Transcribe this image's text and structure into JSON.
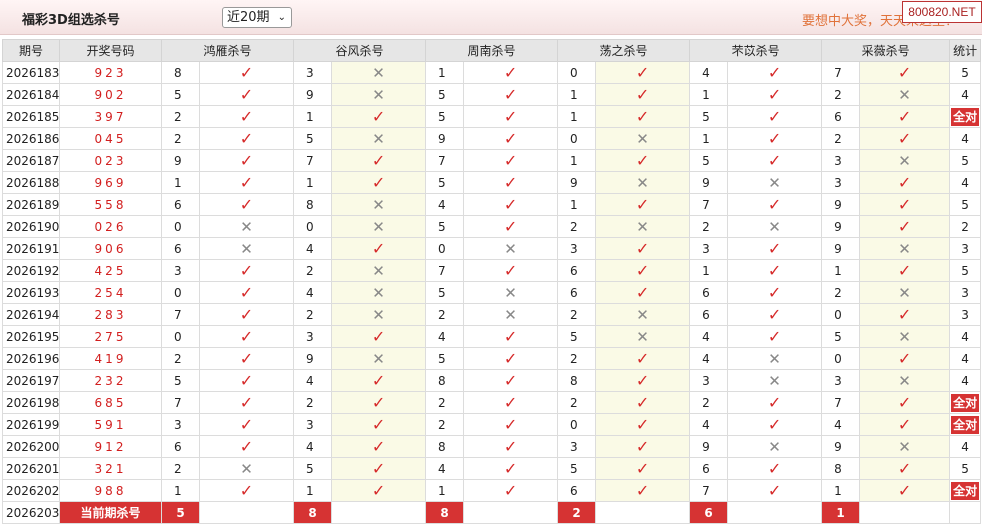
{
  "header": {
    "title": "福彩3D组选杀号",
    "period_select": "近20期",
    "slogan": "要想中大奖，天天来这里！",
    "watermark": "800820.NET"
  },
  "table": {
    "headers": [
      "期号",
      "开奖号码",
      "鸿雁杀号",
      "谷风杀号",
      "周南杀号",
      "荡之杀号",
      "芣苡杀号",
      "采薇杀号",
      "统计"
    ],
    "rows": [
      {
        "p": "2026183",
        "n": "923",
        "k": [
          [
            "8",
            "c"
          ],
          [
            "3",
            "x"
          ],
          [
            "1",
            "c"
          ],
          [
            "0",
            "c"
          ],
          [
            "4",
            "c"
          ],
          [
            "7",
            "c"
          ]
        ],
        "s": "5"
      },
      {
        "p": "2026184",
        "n": "902",
        "k": [
          [
            "5",
            "c"
          ],
          [
            "9",
            "x"
          ],
          [
            "5",
            "c"
          ],
          [
            "1",
            "c"
          ],
          [
            "1",
            "c"
          ],
          [
            "2",
            "x"
          ]
        ],
        "s": "4"
      },
      {
        "p": "2026185",
        "n": "397",
        "k": [
          [
            "2",
            "c"
          ],
          [
            "1",
            "c"
          ],
          [
            "5",
            "c"
          ],
          [
            "1",
            "c"
          ],
          [
            "5",
            "c"
          ],
          [
            "6",
            "c"
          ]
        ],
        "s": "全对"
      },
      {
        "p": "2026186",
        "n": "045",
        "k": [
          [
            "2",
            "c"
          ],
          [
            "5",
            "x"
          ],
          [
            "9",
            "c"
          ],
          [
            "0",
            "x"
          ],
          [
            "1",
            "c"
          ],
          [
            "2",
            "c"
          ]
        ],
        "s": "4"
      },
      {
        "p": "2026187",
        "n": "023",
        "k": [
          [
            "9",
            "c"
          ],
          [
            "7",
            "c"
          ],
          [
            "7",
            "c"
          ],
          [
            "1",
            "c"
          ],
          [
            "5",
            "c"
          ],
          [
            "3",
            "x"
          ]
        ],
        "s": "5"
      },
      {
        "p": "2026188",
        "n": "969",
        "k": [
          [
            "1",
            "c"
          ],
          [
            "1",
            "c"
          ],
          [
            "5",
            "c"
          ],
          [
            "9",
            "x"
          ],
          [
            "9",
            "x"
          ],
          [
            "3",
            "c"
          ]
        ],
        "s": "4"
      },
      {
        "p": "2026189",
        "n": "558",
        "k": [
          [
            "6",
            "c"
          ],
          [
            "8",
            "x"
          ],
          [
            "4",
            "c"
          ],
          [
            "1",
            "c"
          ],
          [
            "7",
            "c"
          ],
          [
            "9",
            "c"
          ]
        ],
        "s": "5"
      },
      {
        "p": "2026190",
        "n": "026",
        "k": [
          [
            "0",
            "x"
          ],
          [
            "0",
            "x"
          ],
          [
            "5",
            "c"
          ],
          [
            "2",
            "x"
          ],
          [
            "2",
            "x"
          ],
          [
            "9",
            "c"
          ]
        ],
        "s": "2"
      },
      {
        "p": "2026191",
        "n": "906",
        "k": [
          [
            "6",
            "x"
          ],
          [
            "4",
            "c"
          ],
          [
            "0",
            "x"
          ],
          [
            "3",
            "c"
          ],
          [
            "3",
            "c"
          ],
          [
            "9",
            "x"
          ]
        ],
        "s": "3"
      },
      {
        "p": "2026192",
        "n": "425",
        "k": [
          [
            "3",
            "c"
          ],
          [
            "2",
            "x"
          ],
          [
            "7",
            "c"
          ],
          [
            "6",
            "c"
          ],
          [
            "1",
            "c"
          ],
          [
            "1",
            "c"
          ]
        ],
        "s": "5"
      },
      {
        "p": "2026193",
        "n": "254",
        "k": [
          [
            "0",
            "c"
          ],
          [
            "4",
            "x"
          ],
          [
            "5",
            "x"
          ],
          [
            "6",
            "c"
          ],
          [
            "6",
            "c"
          ],
          [
            "2",
            "x"
          ]
        ],
        "s": "3"
      },
      {
        "p": "2026194",
        "n": "283",
        "k": [
          [
            "7",
            "c"
          ],
          [
            "2",
            "x"
          ],
          [
            "2",
            "x"
          ],
          [
            "2",
            "x"
          ],
          [
            "6",
            "c"
          ],
          [
            "0",
            "c"
          ]
        ],
        "s": "3"
      },
      {
        "p": "2026195",
        "n": "275",
        "k": [
          [
            "0",
            "c"
          ],
          [
            "3",
            "c"
          ],
          [
            "4",
            "c"
          ],
          [
            "5",
            "x"
          ],
          [
            "4",
            "c"
          ],
          [
            "5",
            "x"
          ]
        ],
        "s": "4"
      },
      {
        "p": "2026196",
        "n": "419",
        "k": [
          [
            "2",
            "c"
          ],
          [
            "9",
            "x"
          ],
          [
            "5",
            "c"
          ],
          [
            "2",
            "c"
          ],
          [
            "4",
            "x"
          ],
          [
            "0",
            "c"
          ]
        ],
        "s": "4"
      },
      {
        "p": "2026197",
        "n": "232",
        "k": [
          [
            "5",
            "c"
          ],
          [
            "4",
            "c"
          ],
          [
            "8",
            "c"
          ],
          [
            "8",
            "c"
          ],
          [
            "3",
            "x"
          ],
          [
            "3",
            "x"
          ]
        ],
        "s": "4"
      },
      {
        "p": "2026198",
        "n": "685",
        "k": [
          [
            "7",
            "c"
          ],
          [
            "2",
            "c"
          ],
          [
            "2",
            "c"
          ],
          [
            "2",
            "c"
          ],
          [
            "2",
            "c"
          ],
          [
            "7",
            "c"
          ]
        ],
        "s": "全对"
      },
      {
        "p": "2026199",
        "n": "591",
        "k": [
          [
            "3",
            "c"
          ],
          [
            "3",
            "c"
          ],
          [
            "2",
            "c"
          ],
          [
            "0",
            "c"
          ],
          [
            "4",
            "c"
          ],
          [
            "4",
            "c"
          ]
        ],
        "s": "全对"
      },
      {
        "p": "2026200",
        "n": "912",
        "k": [
          [
            "6",
            "c"
          ],
          [
            "4",
            "c"
          ],
          [
            "8",
            "c"
          ],
          [
            "3",
            "c"
          ],
          [
            "9",
            "x"
          ],
          [
            "9",
            "x"
          ]
        ],
        "s": "4"
      },
      {
        "p": "2026201",
        "n": "321",
        "k": [
          [
            "2",
            "x"
          ],
          [
            "5",
            "c"
          ],
          [
            "4",
            "c"
          ],
          [
            "5",
            "c"
          ],
          [
            "6",
            "c"
          ],
          [
            "8",
            "c"
          ]
        ],
        "s": "5"
      },
      {
        "p": "2026202",
        "n": "988",
        "k": [
          [
            "1",
            "c"
          ],
          [
            "1",
            "c"
          ],
          [
            "1",
            "c"
          ],
          [
            "6",
            "c"
          ],
          [
            "7",
            "c"
          ],
          [
            "1",
            "c"
          ]
        ],
        "s": "全对"
      }
    ],
    "current": {
      "p": "2026203",
      "label": "当前期杀号",
      "kills": [
        "5",
        "8",
        "8",
        "2",
        "6",
        "1"
      ]
    }
  },
  "icons": {
    "check": "check-icon",
    "cross": "cross-icon"
  },
  "colors": {
    "accent": "#d63333",
    "check": "#d62a2a",
    "cross": "#888888",
    "highlight": "#fafae6",
    "slogan": "#e0723a"
  }
}
